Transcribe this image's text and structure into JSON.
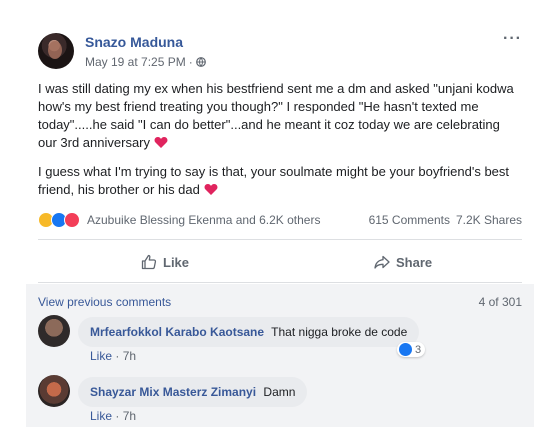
{
  "post": {
    "author": "Snazo Maduna",
    "timestamp": "May 19 at 7:25 PM",
    "meta_sep": "·",
    "more_label": "···",
    "paragraph1": "I was still dating my ex when his bestfriend sent me a dm and asked \"unjani kodwa how's my best friend treating you though?\" I responded \"He hasn't texted me today\".....he said \"I can do better\"...and he meant it coz today we are celebrating our 3rd anniversary",
    "paragraph2": "I guess what I'm trying to say is that, your soulmate might be your boyfriend's best friend, his brother or his dad",
    "reaction_icons": [
      "haha-icon",
      "like-icon",
      "love-icon"
    ],
    "reaction_names": "Azubuike Blessing Ekenma and 6.2K others",
    "comments_count": "615 Comments",
    "shares_count": "7.2K Shares"
  },
  "actions": {
    "like_label": "Like",
    "share_label": "Share"
  },
  "comments": {
    "view_previous": "View previous comments",
    "counter": "4 of 301",
    "items": [
      {
        "name": "Mrfearfokkol Karabo Kaotsane",
        "text": "That nigga broke de code",
        "like": "Like",
        "sep": "·",
        "time": "7h",
        "reactions": "3"
      },
      {
        "name": "Shayzar Mix Masterz Zimanyi",
        "text": "Damn",
        "like": "Like",
        "sep": "·",
        "time": "7h"
      }
    ]
  },
  "colors": {
    "link": "#365899",
    "comment_bubble": "#e9ebee",
    "like_blue": "#1877f2",
    "love_red": "#f33e58",
    "haha_yellow": "#f7b928"
  }
}
